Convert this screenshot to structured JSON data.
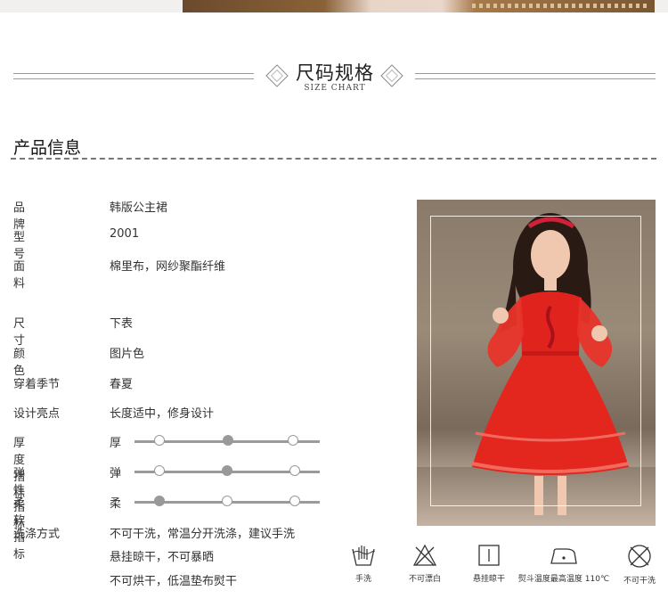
{
  "header": {
    "title_cn": "尺码规格",
    "title_en": "SIZE CHART"
  },
  "section": {
    "title": "产品信息"
  },
  "specs": [
    {
      "label": "品牌",
      "value": "韩版公主裙"
    },
    {
      "label": "型号",
      "value": "2001"
    },
    {
      "label": "面料",
      "value": "棉里布，网纱聚酯纤维"
    },
    {
      "label": "尺寸",
      "value": "下表"
    },
    {
      "label": "颜色",
      "value": "图片色"
    },
    {
      "label": "穿着季节",
      "value": "春夏"
    },
    {
      "label": "设计亮点",
      "value": "长度适中，修身设计"
    }
  ],
  "scales": [
    {
      "label": "厚度指标",
      "first": "厚",
      "selected_index": 1
    },
    {
      "label": "弹性指标",
      "first": "弹",
      "selected_index": 1
    },
    {
      "label": "柔软指标",
      "first": "柔",
      "selected_index": 0
    }
  ],
  "wash": {
    "label": "洗涤方式",
    "lines": [
      "不可干洗，常温分开洗涤，建议手洗",
      "悬挂晾干，不可暴晒",
      "不可烘干，低温垫布熨干"
    ]
  },
  "care_icons": [
    {
      "icon": "hand-wash-icon",
      "label": "手洗"
    },
    {
      "icon": "no-bleach-icon",
      "label": "不可漂白"
    },
    {
      "icon": "hang-dry-icon",
      "label": "悬挂晾干"
    },
    {
      "icon": "iron-icon",
      "label": "熨斗温度最高温度 110℃"
    },
    {
      "icon": "no-dry-clean-icon",
      "label": "不可干洗"
    }
  ],
  "colors": {
    "dress": "#e0231c",
    "accent_gray": "#999999"
  }
}
